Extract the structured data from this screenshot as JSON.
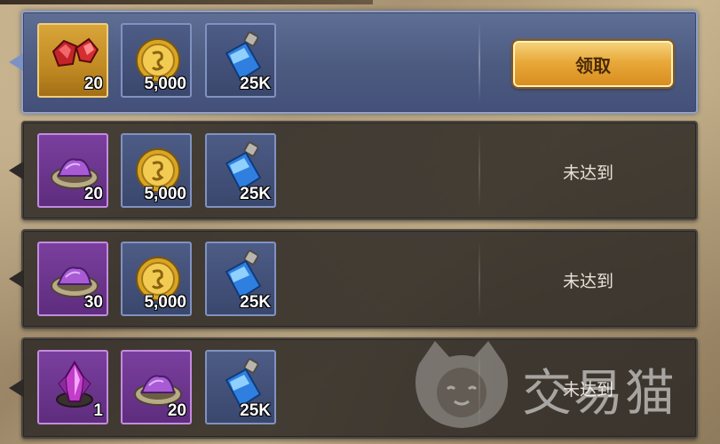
{
  "rows": [
    {
      "state": "active",
      "items": [
        {
          "icon": "red-gems-icon",
          "count": "20"
        },
        {
          "icon": "gold-coin-icon",
          "count": "5,000"
        },
        {
          "icon": "blue-potion-icon",
          "count": "25K"
        }
      ],
      "action_label": "领取"
    },
    {
      "state": "locked",
      "items": [
        {
          "icon": "purple-powder-icon",
          "count": "20"
        },
        {
          "icon": "gold-coin-icon",
          "count": "5,000"
        },
        {
          "icon": "blue-potion-icon",
          "count": "25K"
        }
      ],
      "status_label": "未达到"
    },
    {
      "state": "locked",
      "items": [
        {
          "icon": "purple-powder-icon",
          "count": "30"
        },
        {
          "icon": "gold-coin-icon",
          "count": "5,000"
        },
        {
          "icon": "blue-potion-icon",
          "count": "25K"
        }
      ],
      "status_label": "未达到"
    },
    {
      "state": "locked",
      "items": [
        {
          "icon": "purple-crystal-icon",
          "count": "1"
        },
        {
          "icon": "purple-powder-icon",
          "count": "20"
        },
        {
          "icon": "blue-potion-icon",
          "count": "25K"
        }
      ],
      "status_label": "未达到"
    }
  ],
  "watermark": {
    "text": "交易猫",
    "icon": "cat-logo-icon"
  },
  "colors": {
    "active_row": "#4c5a80",
    "locked_row": "#2e2a27",
    "claim_button": "#e8a93a",
    "gold_slot": "#c18a23",
    "blue_slot": "#3a476d",
    "purple_slot": "#5e2d7e"
  }
}
